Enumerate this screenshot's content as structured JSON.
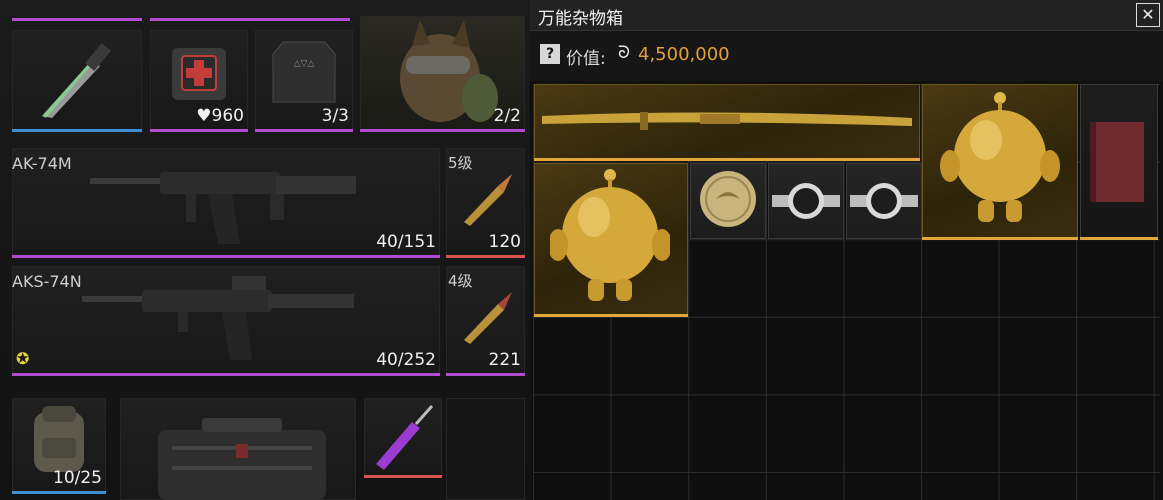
{
  "inventory": {
    "knife": {
      "icon": "knife-icon"
    },
    "medkit": {
      "qty": "960",
      "icon": "heart-icon"
    },
    "armor_plate": {
      "qty": "3/3"
    },
    "dog": {
      "qty": "2/2"
    },
    "primary": {
      "name": "AK-74M",
      "ammo": "40/151"
    },
    "ammo1": {
      "level": "5级",
      "count": "120"
    },
    "secondary": {
      "name": "AKS-74N",
      "ammo": "40/252"
    },
    "ammo2": {
      "level": "4级",
      "count": "221"
    },
    "backpack": {
      "qty": "10/25"
    }
  },
  "container": {
    "title": "万能杂物箱",
    "value_label": "价值:",
    "value": "4,500,000",
    "help_icon": "?",
    "coin_icon": "coin-icon"
  },
  "colors": {
    "purple": "#b24bcf",
    "blue": "#3f8fd4",
    "red": "#d9534f",
    "gold": "#e2a63a",
    "value": "#e3a038"
  }
}
